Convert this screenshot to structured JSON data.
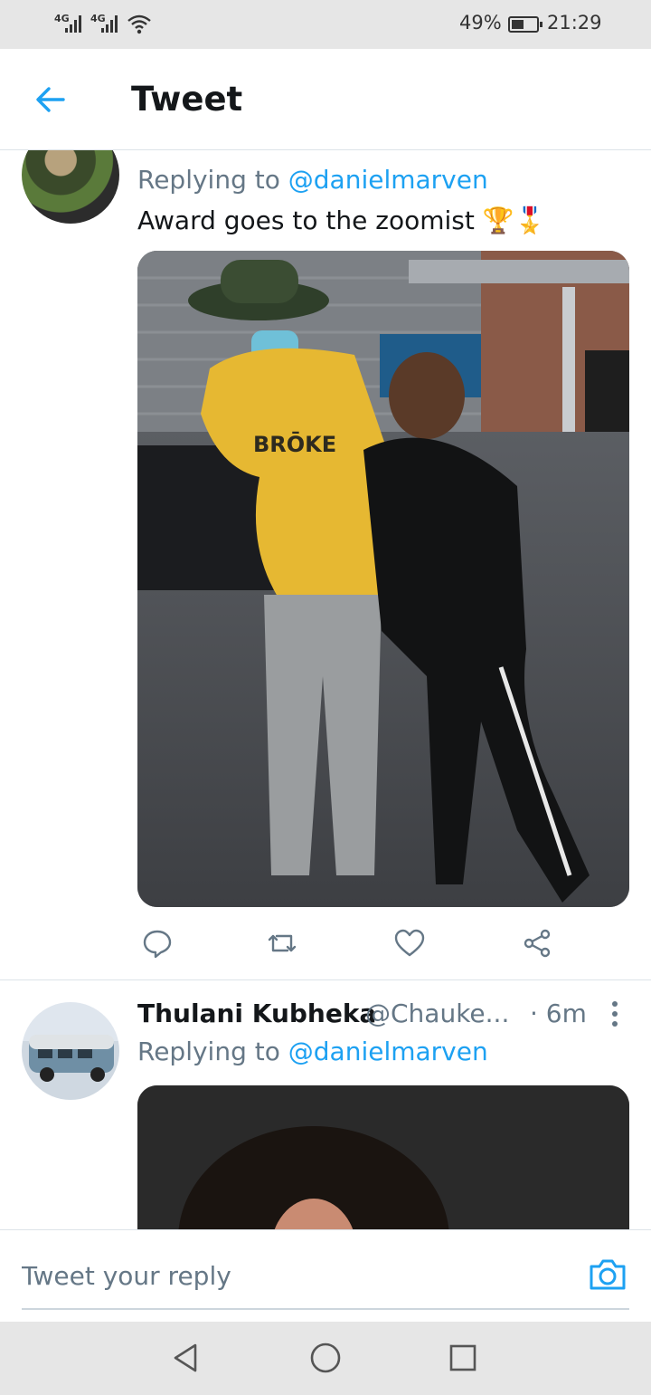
{
  "status_bar": {
    "network_1": "4G",
    "network_2": "4G",
    "battery_percent": "49%",
    "battery_level": 0.49,
    "time": "21:29"
  },
  "header": {
    "back_icon": "arrow-left-icon",
    "title": "Tweet"
  },
  "tweets": [
    {
      "reply_prefix": "Replying to",
      "reply_handle": "@danielmarven",
      "text": "Award goes to the zoomist 🏆🎖️",
      "actions": [
        "reply-icon",
        "retweet-icon",
        "like-icon",
        "share-icon"
      ]
    },
    {
      "name": "Thulani Kubheka",
      "handle": "@Chauke...",
      "time": "· 6m",
      "reply_prefix": "Replying to",
      "reply_handle": "@danielmarven"
    }
  ],
  "reply_bar": {
    "placeholder": "Tweet your reply",
    "camera_icon": "camera-icon"
  },
  "navbar": {
    "buttons": [
      "back-triangle-icon",
      "home-circle-icon",
      "recents-square-icon"
    ]
  },
  "colors": {
    "accent": "#1da1f2",
    "text": "#14171a",
    "muted": "#657786"
  }
}
